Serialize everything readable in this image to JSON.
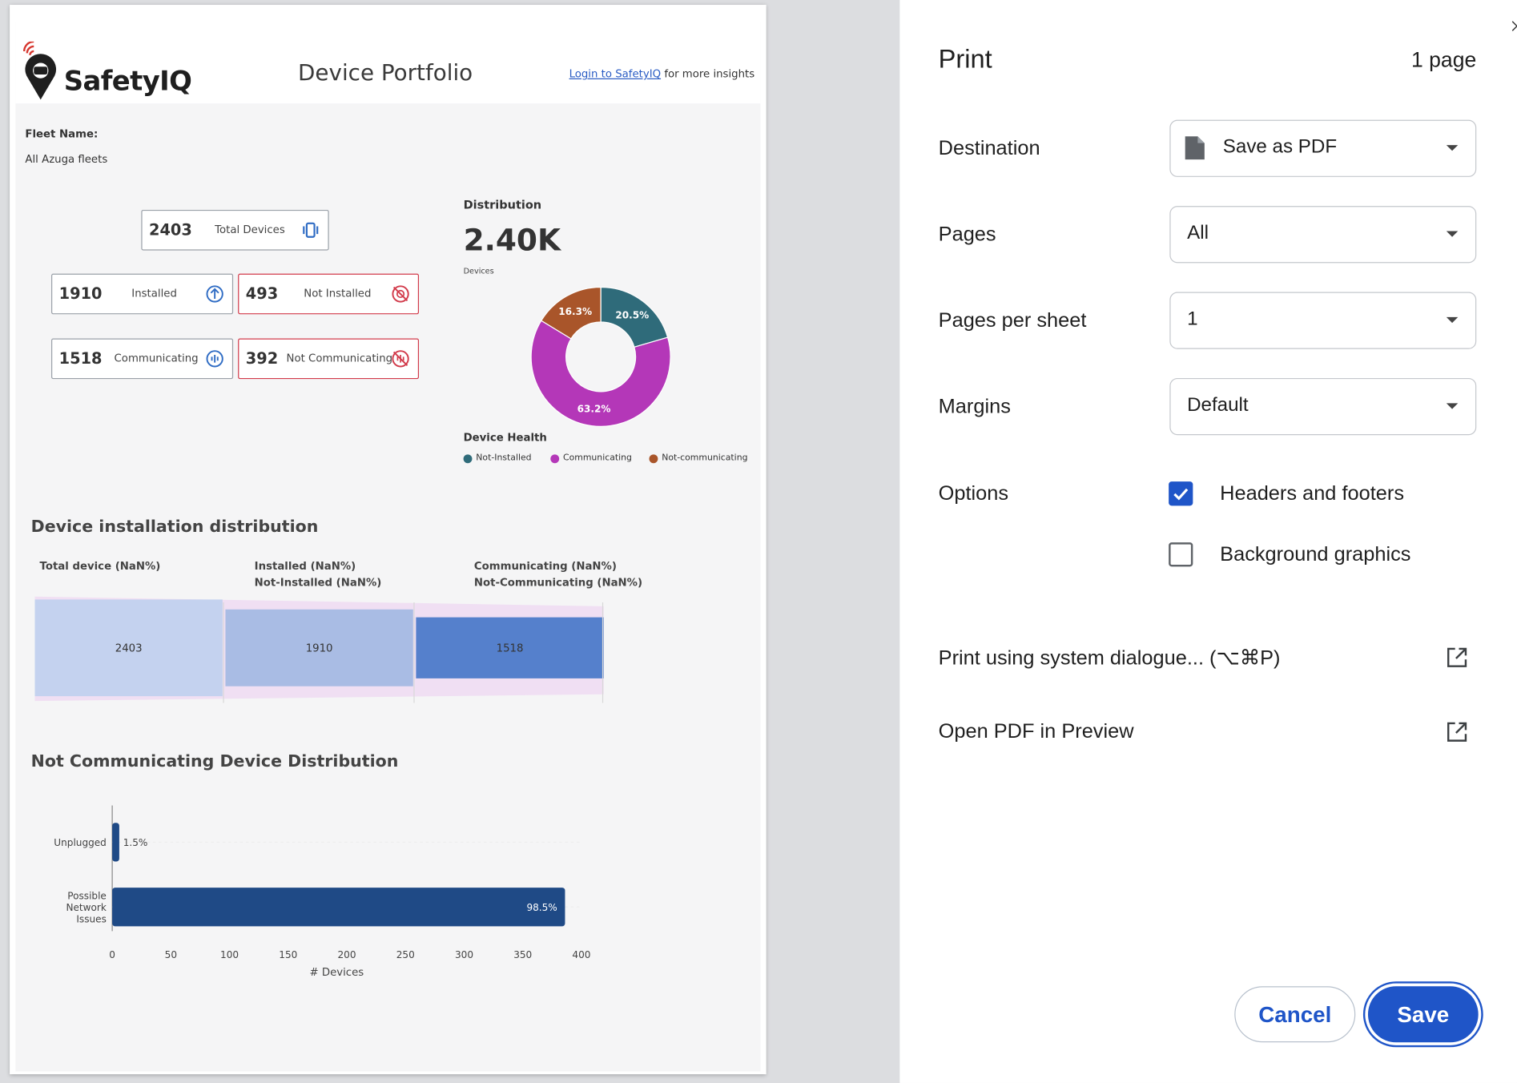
{
  "report": {
    "logo_text": "SafetyIQ",
    "title": "Device Portfolio",
    "login_link": "Login to SafetyIQ",
    "login_suffix": " for more insights",
    "fleet_label": "Fleet Name:",
    "fleet_value": "All Azuga fleets",
    "kpis": {
      "total": {
        "value": "2403",
        "label": "Total Devices"
      },
      "installed": {
        "value": "1910",
        "label": "Installed"
      },
      "not_installed": {
        "value": "493",
        "label": "Not Installed"
      },
      "communicating": {
        "value": "1518",
        "label": "Communicating"
      },
      "not_communicating": {
        "value": "392",
        "label": "Not Communicating"
      }
    },
    "distribution": {
      "title": "Distribution",
      "big_value": "2.40K",
      "big_label": "Devices",
      "health_title": "Device Health",
      "legend": [
        "Not-Installed",
        "Communicating",
        "Not-communicating"
      ]
    },
    "installation_section": {
      "title": "Device installation distribution",
      "col1": "Total device (NaN%)",
      "col2_line1": "Installed (NaN%)",
      "col2_line2": "Not-Installed (NaN%)",
      "col3_line1": "Communicating (NaN%)",
      "col3_line2": "Not-Communicating (NaN%)"
    },
    "not_comm_section": {
      "title": "Not Communicating Device Distribution"
    }
  },
  "chart_data": [
    {
      "type": "pie",
      "title": "Distribution",
      "slices": [
        {
          "label": "Not-Installed",
          "value": 20.5,
          "color": "#2f6b7a"
        },
        {
          "label": "Communicating",
          "value": 63.2,
          "color": "#b437b8"
        },
        {
          "label": "Not-communicating",
          "value": 16.3,
          "color": "#a9552a"
        }
      ],
      "slice_labels": [
        "20.5%",
        "63.2%",
        "16.3%"
      ],
      "legend_placement": "bottom"
    },
    {
      "type": "bar",
      "title": "Device installation distribution",
      "categories": [
        "Total device",
        "Installed",
        "Communicating"
      ],
      "values": [
        2403,
        1910,
        1518
      ],
      "value_labels": [
        "2403",
        "1910",
        "1518"
      ],
      "colors": [
        "#c4d2ef",
        "#a9bce4",
        "#5580cc"
      ]
    },
    {
      "type": "bar",
      "orientation": "horizontal",
      "title": "Not Communicating Device Distribution",
      "categories": [
        "Unplugged",
        "Possible Network Issues"
      ],
      "category_lines": [
        [
          "Unplugged"
        ],
        [
          "Possible",
          "Network",
          "Issues"
        ]
      ],
      "values": [
        6,
        386
      ],
      "value_labels": [
        "1.5%",
        "98.5%"
      ],
      "xlabel": "# Devices",
      "xlim": [
        0,
        400
      ],
      "xticks": [
        0,
        50,
        100,
        150,
        200,
        250,
        300,
        350,
        400
      ],
      "color": "#1f4a86"
    }
  ],
  "print_panel": {
    "title": "Print",
    "page_count": "1 page",
    "destination_label": "Destination",
    "destination_value": "Save as PDF",
    "pages_label": "Pages",
    "pages_value": "All",
    "pps_label": "Pages per sheet",
    "pps_value": "1",
    "margins_label": "Margins",
    "margins_value": "Default",
    "options_label": "Options",
    "opt_headers": "Headers and footers",
    "opt_background": "Background graphics",
    "system_dialog": "Print using system dialogue... (⌥⌘P)",
    "open_preview": "Open PDF in Preview",
    "cancel": "Cancel",
    "save": "Save"
  },
  "colors": {
    "accent": "#1f55c8",
    "alert": "#d23b4b",
    "kpi_icon_blue": "#2f6cc4"
  }
}
